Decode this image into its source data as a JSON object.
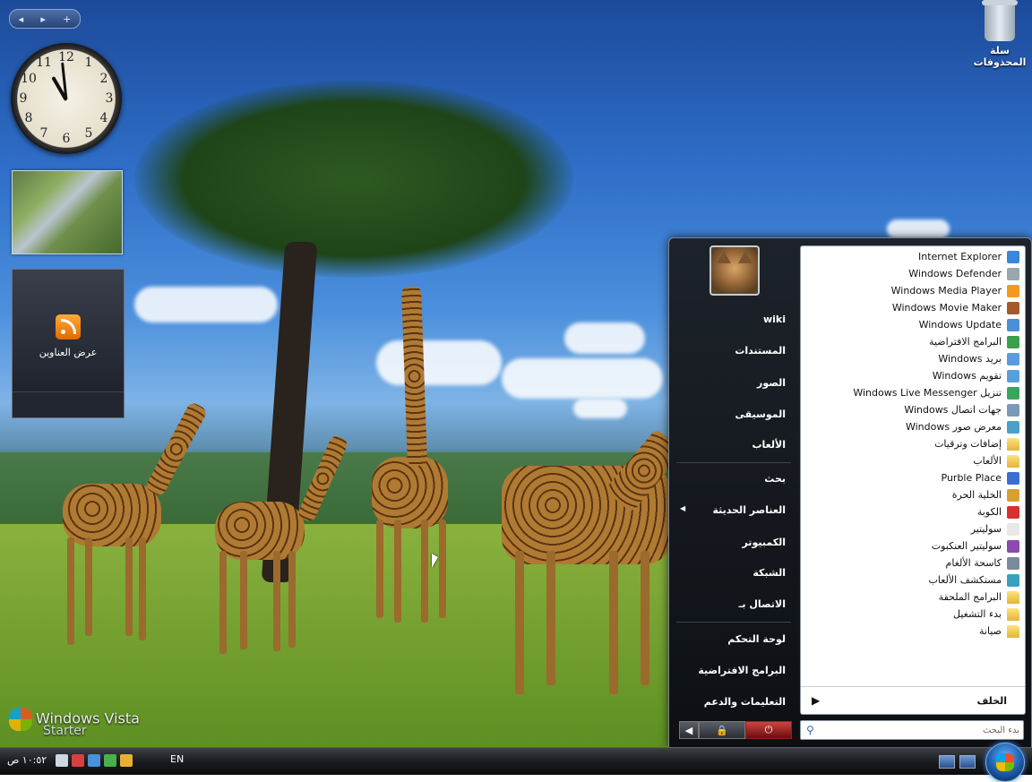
{
  "desktop": {
    "recycle_bin_label": "سلة المحذوفات",
    "vista_logo_text": "Windows Vista",
    "vista_edition": "Starter"
  },
  "gadgets": {
    "toolbar": {
      "prev": "◂",
      "next": "▸",
      "add": "+"
    },
    "clock": {
      "numbers": [
        "12",
        "1",
        "2",
        "3",
        "4",
        "5",
        "6",
        "7",
        "8",
        "9",
        "10",
        "11"
      ]
    },
    "feeds_label": "عرض العناوين"
  },
  "start_menu": {
    "programs": [
      {
        "label": "Internet Explorer",
        "icon": "internet-explorer-icon",
        "color": "#3a86d8"
      },
      {
        "label": "Windows Defender",
        "icon": "defender-icon",
        "color": "#9aa6b0"
      },
      {
        "label": "Windows Media Player",
        "icon": "media-player-icon",
        "color": "#f39a1e"
      },
      {
        "label": "Windows Movie Maker",
        "icon": "movie-maker-icon",
        "color": "#a8592a"
      },
      {
        "label": "Windows Update",
        "icon": "update-icon",
        "color": "#4a8fd8"
      },
      {
        "label": "البرامج الافتراضية",
        "icon": "default-programs-icon",
        "color": "#3aa04a"
      },
      {
        "label": "بريد Windows",
        "icon": "mail-icon",
        "color": "#5b9be0"
      },
      {
        "label": "تقويم Windows",
        "icon": "calendar-icon",
        "color": "#5aa0d8"
      },
      {
        "label": "تنزيل Windows Live Messenger",
        "icon": "messenger-icon",
        "color": "#39a55c"
      },
      {
        "label": "جهات اتصال Windows",
        "icon": "contacts-icon",
        "color": "#7a9ab8"
      },
      {
        "label": "معرض صور Windows",
        "icon": "photo-gallery-icon",
        "color": "#4aa0c8"
      },
      {
        "label": "إضافات وترقيات",
        "icon": "folder-icon",
        "folder": true
      },
      {
        "label": "الألعاب",
        "icon": "folder-icon",
        "folder": true
      },
      {
        "label": "Purble Place",
        "icon": "purble-place-icon",
        "color": "#3a6fd0"
      },
      {
        "label": "الخلية الحرة",
        "icon": "freecell-icon",
        "color": "#d8a030"
      },
      {
        "label": "الكوبة",
        "icon": "hearts-icon",
        "color": "#d83030"
      },
      {
        "label": "سوليتير",
        "icon": "solitaire-icon",
        "color": "#e8e8e8"
      },
      {
        "label": "سوليتير العنكبوت",
        "icon": "spider-solitaire-icon",
        "color": "#8a4ab0"
      },
      {
        "label": "كاسحة الألغام",
        "icon": "minesweeper-icon",
        "color": "#7a8a9a"
      },
      {
        "label": "مستكشف الألعاب",
        "icon": "games-explorer-icon",
        "color": "#3aa0c0"
      },
      {
        "label": "البرامج الملحقة",
        "icon": "folder-icon",
        "folder": true
      },
      {
        "label": "بدء التشغيل",
        "icon": "folder-icon",
        "folder": true
      },
      {
        "label": "صيانة",
        "icon": "folder-icon",
        "folder": true
      }
    ],
    "back_label": "الخلف",
    "search_placeholder": "بدء البحث",
    "right_group1": [
      "wiki",
      "المستندات",
      "الصور",
      "الموسيقى",
      "الألعاب"
    ],
    "right_group2": [
      "بحث",
      "العناصر الحديثة",
      "الكمبيوتر",
      "الشبكة",
      "الاتصال بـ"
    ],
    "right_group3": [
      "لوحة التحكم",
      "البرامج الافتراضية",
      "التعليمات والدعم"
    ]
  },
  "taskbar": {
    "clock": "١٠:٥٢ ص",
    "language": "EN"
  },
  "colors": {
    "start_orb": "#1c5aa8",
    "power_button": "#c94646"
  }
}
